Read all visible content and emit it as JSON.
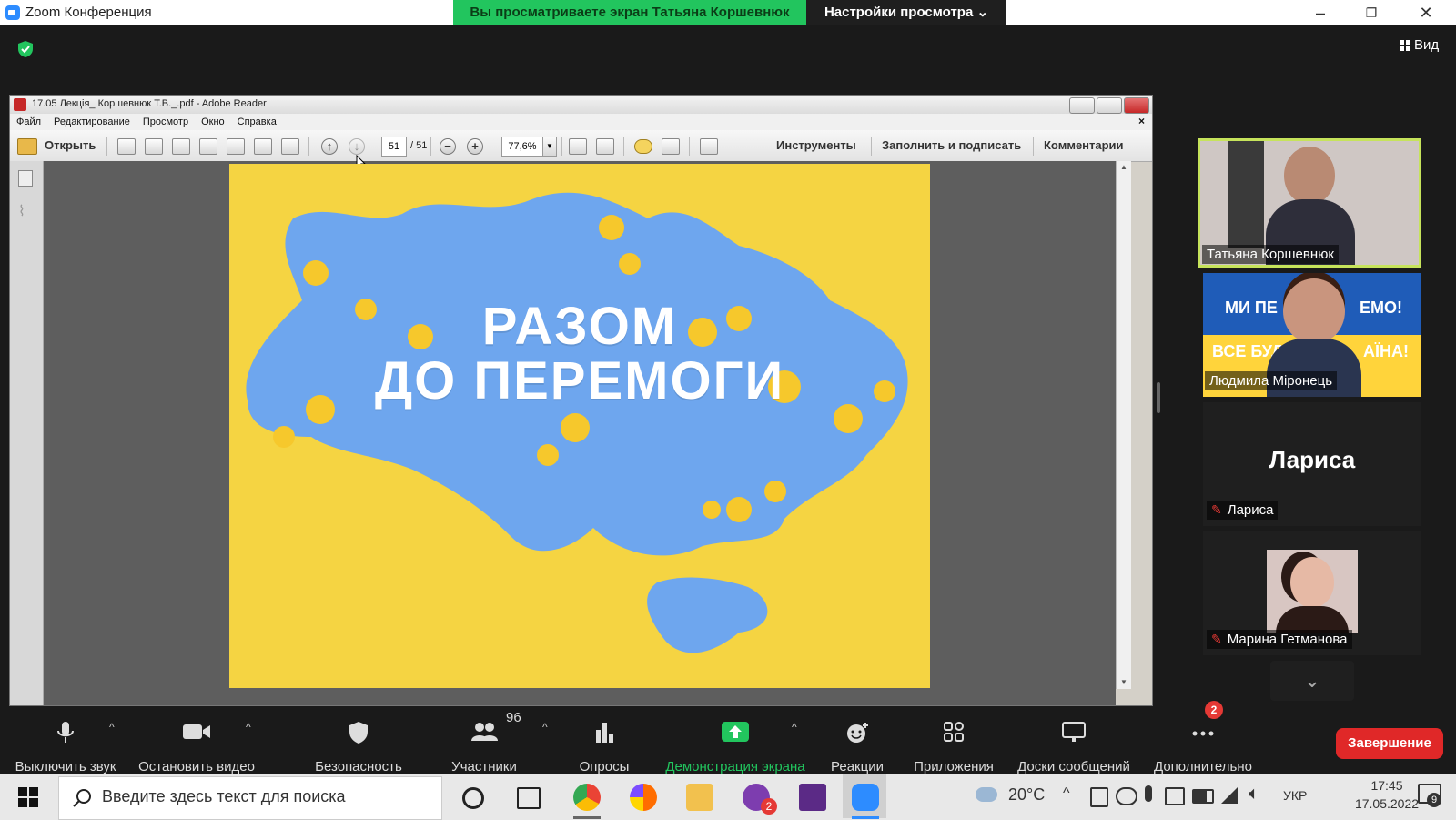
{
  "zoom": {
    "window_title": "Zoom Конференция",
    "share_banner": "Вы просматриваете экран Татьяна Коршевнюк",
    "view_settings_label": "Настройки просмотра",
    "view_button_label": "Вид"
  },
  "reader": {
    "window_title": "17.05 Лекція_ Коршевнюк Т.В._.pdf - Adobe Reader",
    "menu": [
      "Файл",
      "Редактирование",
      "Просмотр",
      "Окно",
      "Справка"
    ],
    "open_label": "Открыть",
    "page_current": "51",
    "page_total": "/ 51",
    "zoom_value": "77,6%",
    "tools_label": "Инструменты",
    "sign_label": "Заполнить и подписать",
    "comments_label": "Комментарии"
  },
  "slide": {
    "line1": "РАЗОМ",
    "line2": "ДО ПЕРЕМОГИ",
    "colors": {
      "background": "#f5d442",
      "map": "#6ea6ee",
      "flowers": "#f6c82c"
    }
  },
  "gallery": {
    "participants": [
      {
        "name": "Татьяна Коршевнюк",
        "muted": false,
        "highlighted": true
      },
      {
        "name": "Людмила Міронець",
        "muted": false,
        "banner_top": "МИ ПЕ",
        "banner_top_right": "ЕМО!",
        "banner_bottom": "ВСЕ БУД",
        "banner_bottom_right": "АЇНА!"
      },
      {
        "name": "Лариса",
        "display_name": "Лариса",
        "muted": true
      },
      {
        "name": "Марина Гетманова",
        "muted": true
      }
    ]
  },
  "controls": {
    "mute_label": "Выключить звук",
    "video_label": "Остановить видео",
    "security_label": "Безопасность",
    "participants_label": "Участники",
    "participants_count": "96",
    "polls_label": "Опросы",
    "share_label": "Демонстрация экрана",
    "reactions_label": "Реакции",
    "apps_label": "Приложения",
    "whiteboards_label": "Доски сообщений",
    "more_label": "Дополнительно",
    "more_badge": "2",
    "end_label": "Завершение",
    "share_color": "#22c55e",
    "end_color": "#e02828"
  },
  "taskbar": {
    "search_placeholder": "Введите здесь текст для поиска",
    "viber_badge": "2",
    "temperature": "20°C",
    "language": "УКР",
    "time": "17:45",
    "date": "17.05.2022",
    "notifications": "9"
  }
}
